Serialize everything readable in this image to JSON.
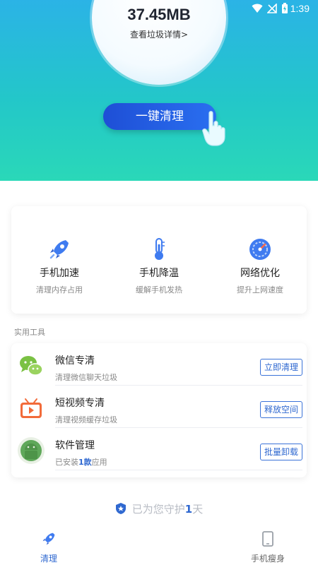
{
  "status_bar": {
    "time": "1:39"
  },
  "hero": {
    "junk_size": "37.45MB",
    "details_link": "查看垃圾详情>",
    "clean_button": "一键清理"
  },
  "features": [
    {
      "icon": "rocket-icon",
      "title": "手机加速",
      "subtitle": "清理内存占用"
    },
    {
      "icon": "thermometer-icon",
      "title": "手机降温",
      "subtitle": "缓解手机发热"
    },
    {
      "icon": "speedometer-icon",
      "title": "网络优化",
      "subtitle": "提升上网速度"
    }
  ],
  "tools": {
    "section_label": "实用工具",
    "rows": [
      {
        "icon": "wechat-icon",
        "title": "微信专清",
        "subtitle": "清理微信聊天垃圾",
        "button": "立即清理"
      },
      {
        "icon": "video-icon",
        "title": "短视频专清",
        "subtitle": "清理视频缓存垃圾",
        "button": "释放空间"
      },
      {
        "icon": "android-icon",
        "title": "软件管理",
        "subtitle_prefix": "已安装",
        "subtitle_count": "1款",
        "subtitle_suffix": "应用",
        "button": "批量卸载"
      }
    ]
  },
  "guard": {
    "prefix": "已为您守护",
    "days": "1",
    "suffix": "天"
  },
  "bottom_nav": [
    {
      "icon": "rocket-icon",
      "label": "清理",
      "active": true
    },
    {
      "icon": "phone-icon",
      "label": "手机瘦身",
      "active": false
    }
  ],
  "colors": {
    "accent": "#2f68d0",
    "hero_top": "#2bb3e6",
    "hero_bottom": "#2ad8b8"
  }
}
